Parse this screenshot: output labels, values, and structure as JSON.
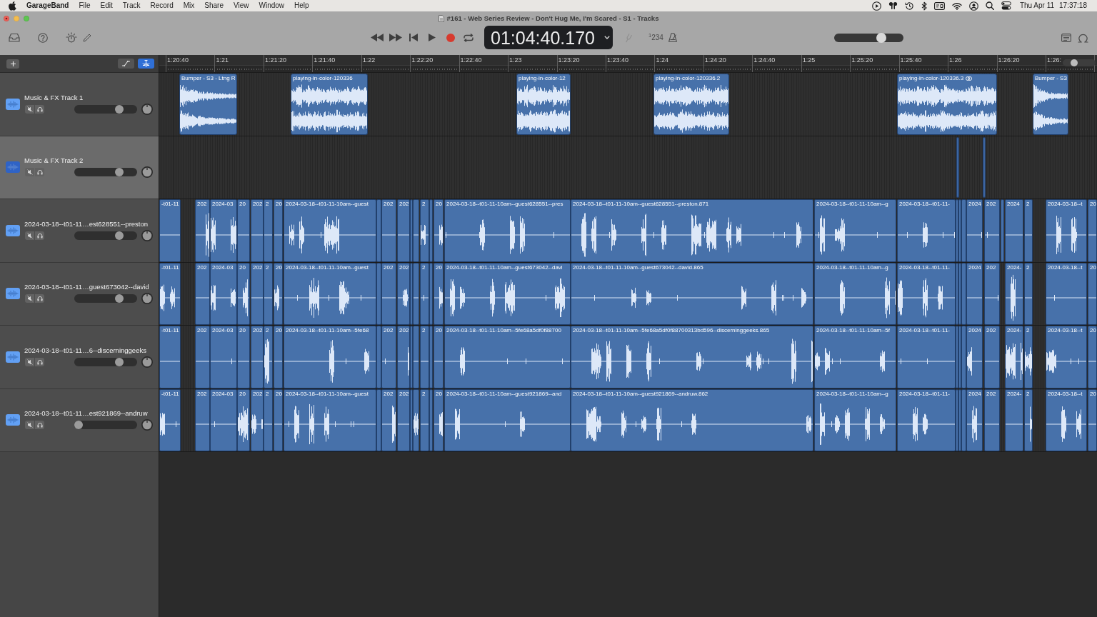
{
  "menu_bar": {
    "app_name": "GarageBand",
    "menus": [
      "File",
      "Edit",
      "Track",
      "Record",
      "Mix",
      "Share",
      "View",
      "Window",
      "Help"
    ],
    "date": "Thu Apr 11",
    "time": "17:37:18"
  },
  "window": {
    "title": "#161 - Web Series Review - Don't Hug Me, I'm Scared - S1 - Tracks"
  },
  "toolbar": {
    "time_display": "01:04:40.170",
    "count_in": "$^{1}$234",
    "master_volume": {
      "level": 0.71
    }
  },
  "track_header_bar": {
    "automation": {
      "on": false
    },
    "flex": {
      "on": true
    }
  },
  "ruler": {
    "labels": [
      "1:20:40",
      "1:21",
      "1:21:20",
      "1:21:40",
      "1:22",
      "1:22:20",
      "1:22:40",
      "1:23",
      "1:23:20",
      "1:23:40",
      "1:24",
      "1:24:20",
      "1:24:40",
      "1:25",
      "1:25:20",
      "1:25:40",
      "1:26",
      "1:26:20",
      "1:26:"
    ],
    "zoom": {
      "level": 0.3
    }
  },
  "tracks": [
    {
      "name": "Music & FX Track 1",
      "selected": false,
      "muted": false,
      "solo": false,
      "volume": {
        "level": 0.75
      },
      "regions": [
        {
          "label": "Bumper - S3 - Ltng R",
          "selected": false
        },
        {
          "label": "playing-in-color-120336",
          "selected": false
        },
        {
          "label": "playing-in-color-12",
          "selected": false
        },
        {
          "label": "playing-in-color-120336.2",
          "selected": false
        },
        {
          "label": "playing-in-color-120336.3",
          "selected": false,
          "linked": true
        },
        {
          "label": "Bumper - S3",
          "selected": false
        }
      ]
    },
    {
      "name": "Music & FX Track 2",
      "selected": true,
      "muted": false,
      "solo": false,
      "volume": {
        "level": 0.75
      },
      "regions": [
        {
          "selected": false
        },
        {
          "selected": false
        }
      ]
    },
    {
      "name": "2024-03-18--t01-11…est628551--preston",
      "selected": false,
      "muted": false,
      "solo": false,
      "volume": {
        "level": 0.75
      },
      "regions": [
        {
          "label": "-t01-11",
          "selected": false
        },
        {
          "label": "202",
          "selected": false
        },
        {
          "label": "2024-03",
          "selected": false
        },
        {
          "label": "20",
          "selected": false
        },
        {
          "label": "202",
          "selected": false
        },
        {
          "label": "2",
          "selected": false
        },
        {
          "label": "20",
          "selected": false
        },
        {
          "label": "2024-03-18--t01-11-10am--guest",
          "selected": false
        },
        {
          "selected": false
        },
        {
          "label": "202",
          "selected": false
        },
        {
          "label": "202",
          "selected": false
        },
        {
          "selected": false
        },
        {
          "selected": false
        },
        {
          "label": "2",
          "selected": false
        },
        {
          "selected": false
        },
        {
          "label": "20",
          "selected": false
        },
        {
          "label": "2024-03-18--t01-11-10am--guest628551--pres",
          "selected": false
        },
        {
          "label": "2024-03-18--t01-11-10am--guest628551--preston.871",
          "selected": false
        },
        {
          "label": "2024-03-18--t01-11-10am--g",
          "selected": false
        },
        {
          "label": "2024-03-18--t01-11-",
          "selected": false
        },
        {
          "selected": false
        },
        {
          "selected": false
        },
        {
          "selected": false
        },
        {
          "label": "2024",
          "selected": false
        },
        {
          "label": "202",
          "selected": false
        },
        {
          "selected": false
        },
        {
          "label": "2024",
          "selected": false
        },
        {
          "label": "2",
          "selected": false
        },
        {
          "label": "2024-03-18--t",
          "selected": false
        },
        {
          "label": "20",
          "selected": false
        }
      ]
    },
    {
      "name": "2024-03-18--t01-11…guest673042--david",
      "selected": false,
      "muted": false,
      "solo": false,
      "volume": {
        "level": 0.75
      },
      "regions": [
        {
          "label": "-t01-11",
          "selected": false
        },
        {
          "label": "202",
          "selected": false
        },
        {
          "label": "2024-03",
          "selected": false
        },
        {
          "label": "20",
          "selected": false
        },
        {
          "label": "202",
          "selected": false
        },
        {
          "label": "2",
          "selected": false
        },
        {
          "label": "20",
          "selected": false
        },
        {
          "label": "2024-03-18--t01-11-10am--guest",
          "selected": false
        },
        {
          "selected": false
        },
        {
          "label": "202",
          "selected": false
        },
        {
          "label": "202",
          "selected": false
        },
        {
          "selected": false
        },
        {
          "selected": false
        },
        {
          "label": "2",
          "selected": false
        },
        {
          "selected": false
        },
        {
          "label": "20",
          "selected": false
        },
        {
          "label": "2024-03-18--t01-11-10am--guest673042--davi",
          "selected": false
        },
        {
          "label": "2024-03-18--t01-11-10am--guest673042--david.865",
          "selected": false
        },
        {
          "label": "2024-03-18--t01-11-10am--g",
          "selected": false
        },
        {
          "label": "2024-03-18--t01-11-",
          "selected": false
        },
        {
          "selected": false
        },
        {
          "selected": false
        },
        {
          "selected": false
        },
        {
          "label": "2024",
          "selected": false
        },
        {
          "label": "202",
          "selected": false
        },
        {
          "label": "2024-",
          "selected": false
        },
        {
          "label": "2",
          "selected": false
        },
        {
          "label": "2024-03-18--t",
          "selected": false
        },
        {
          "label": "20",
          "selected": false
        }
      ]
    },
    {
      "name": "2024-03-18--t01-11…6--discerninggeeks",
      "selected": false,
      "muted": false,
      "solo": false,
      "volume": {
        "level": 0.75
      },
      "regions": [
        {
          "label": "-t01-11",
          "selected": false
        },
        {
          "label": "202",
          "selected": false
        },
        {
          "label": "2024-03",
          "selected": false
        },
        {
          "label": "20",
          "selected": false
        },
        {
          "label": "202",
          "selected": false
        },
        {
          "label": "2",
          "selected": false
        },
        {
          "label": "20",
          "selected": false
        },
        {
          "label": "2024-03-18--t01-11-10am--5fe68",
          "selected": false
        },
        {
          "selected": false
        },
        {
          "label": "202",
          "selected": false
        },
        {
          "label": "202",
          "selected": false
        },
        {
          "selected": false
        },
        {
          "selected": false
        },
        {
          "label": "2",
          "selected": false
        },
        {
          "selected": false
        },
        {
          "label": "20",
          "selected": false
        },
        {
          "label": "2024-03-18--t01-11-10am--5fe68a5df0f88700",
          "selected": false
        },
        {
          "label": "2024-03-18--t01-11-10am--5fe68a5df0f88700313bd596--discerninggeeks.865",
          "selected": false
        },
        {
          "label": "2024-03-18--t01-11-10am--5f",
          "selected": false
        },
        {
          "label": "2024-03-18--t01-11-",
          "selected": false
        },
        {
          "selected": false
        },
        {
          "selected": false
        },
        {
          "selected": false
        },
        {
          "label": "2024",
          "selected": false
        },
        {
          "label": "202",
          "selected": false
        },
        {
          "label": "2024-",
          "selected": false
        },
        {
          "label": "2",
          "selected": false
        },
        {
          "label": "2024-03-18--t",
          "selected": false
        },
        {
          "label": "20",
          "selected": false
        }
      ]
    },
    {
      "name": "2024-03-18--t01-11…est921869--andruw",
      "selected": false,
      "muted": false,
      "solo": false,
      "volume": {
        "level": 0
      },
      "regions": [
        {
          "label": "-t01-11",
          "selected": false
        },
        {
          "label": "202",
          "selected": false
        },
        {
          "label": "2024-03",
          "selected": false
        },
        {
          "label": "20",
          "selected": false
        },
        {
          "label": "202",
          "selected": false
        },
        {
          "label": "2",
          "selected": false
        },
        {
          "label": "20",
          "selected": false
        },
        {
          "label": "2024-03-18--t01-11-10am--guest",
          "selected": false
        },
        {
          "selected": false
        },
        {
          "label": "202",
          "selected": false
        },
        {
          "label": "202",
          "selected": false
        },
        {
          "selected": false
        },
        {
          "selected": false
        },
        {
          "label": "2",
          "selected": false
        },
        {
          "selected": false
        },
        {
          "label": "20",
          "selected": false
        },
        {
          "label": "2024-03-18--t01-11-10am--guest921869--and",
          "selected": false
        },
        {
          "label": "2024-03-18--t01-11-10am--guest921869--andruw.862",
          "selected": false
        },
        {
          "label": "2024-03-18--t01-11-10am--g",
          "selected": false
        },
        {
          "label": "2024-03-18--t01-11-",
          "selected": false
        },
        {
          "selected": false
        },
        {
          "selected": false
        },
        {
          "selected": false
        },
        {
          "label": "2024",
          "selected": false
        },
        {
          "label": "202",
          "selected": false
        },
        {
          "label": "2024-",
          "selected": false
        },
        {
          "label": "2",
          "selected": false
        },
        {
          "label": "2024-03-18--t",
          "selected": false
        },
        {
          "label": "20",
          "selected": false
        }
      ]
    }
  ]
}
